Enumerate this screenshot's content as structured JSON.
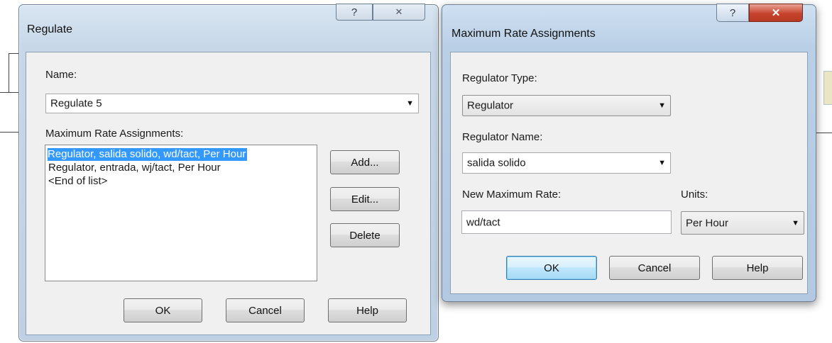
{
  "regulate_dialog": {
    "title": "Regulate",
    "help_glyph": "?",
    "close_glyph": "✕",
    "name_label": "Name:",
    "name_value": "Regulate 5",
    "assignments_label": "Maximum Rate Assignments:",
    "assignments": [
      "Regulator, salida solido, wd/tact, Per Hour",
      "Regulator, entrada, wj/tact, Per Hour",
      "<End of list>"
    ],
    "add_label": "Add...",
    "edit_label": "Edit...",
    "delete_label": "Delete",
    "ok_label": "OK",
    "cancel_label": "Cancel",
    "help_label": "Help"
  },
  "assign_dialog": {
    "title": "Maximum Rate Assignments",
    "help_glyph": "?",
    "close_glyph": "✕",
    "regulator_type_label": "Regulator Type:",
    "regulator_type_value": "Regulator",
    "regulator_name_label": "Regulator Name:",
    "regulator_name_value": "salida solido",
    "new_rate_label": "New Maximum Rate:",
    "new_rate_value": "wd/tact",
    "units_label": "Units:",
    "units_value": "Per Hour",
    "ok_label": "OK",
    "cancel_label": "Cancel",
    "help_label": "Help"
  },
  "colors": {
    "close_red": "#c7432f",
    "selection_blue": "#3399ff"
  }
}
